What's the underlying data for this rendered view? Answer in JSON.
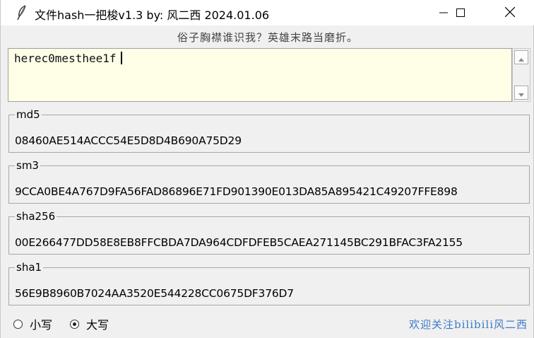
{
  "window": {
    "title": "文件hash一把梭v1.3  by: 风二西 2024.01.06",
    "icons": {
      "app": "feather-icon",
      "minimize": "minimize-icon",
      "maximize": "maximize-icon",
      "close": "close-icon"
    }
  },
  "motto": "俗子胸襟谁识我？英雄末路当磨折。",
  "input": {
    "value": "herec0mesthee1f"
  },
  "hashes": [
    {
      "label": "md5",
      "value": "08460AE514ACCC54E5D8D4B690A75D29"
    },
    {
      "label": "sm3",
      "value": "9CCA0BE4A767D9FA56FAD86896E71FD901390E013DA85A895421C49207FFE898"
    },
    {
      "label": "sha256",
      "value": "00E266477DD58E8EB8FFCBDA7DA964CDFDFEB5CAEA271145BC291BFAC3FA2155"
    },
    {
      "label": "sha1",
      "value": "56E9B8960B7024AA3520E544228CC0675DF376D7"
    }
  ],
  "case_options": {
    "lower_label": "小写",
    "upper_label": "大写",
    "selected": "upper"
  },
  "credit": "欢迎关注bilibili风二西",
  "colors": {
    "input_bg": "#ffffe8",
    "credit": "#3c7bc8",
    "window_bg": "#f0f0f0"
  }
}
